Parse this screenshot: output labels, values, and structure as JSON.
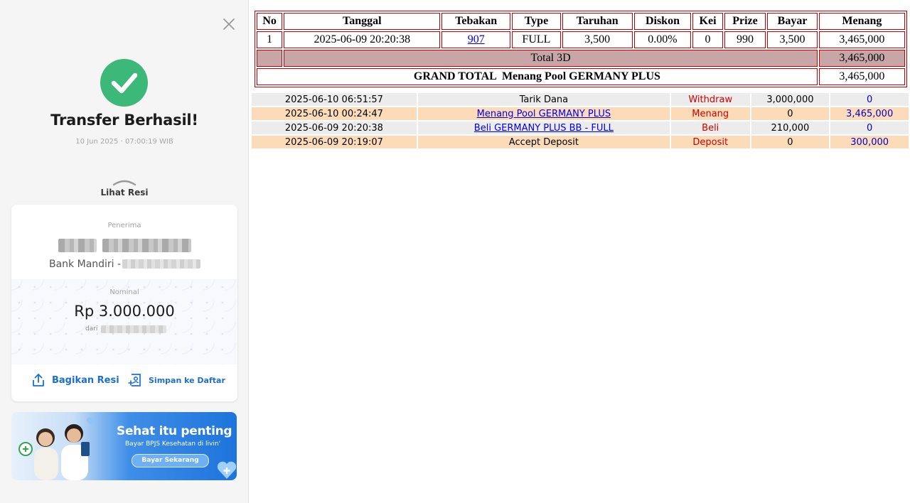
{
  "receipt": {
    "close_icon": "close-icon",
    "success_icon": "check-circle-icon",
    "title": "Transfer Berhasil!",
    "date": "10 Jun 2025 · 07:00:19 WIB",
    "view_receipt": "Lihat Resi",
    "recipient_caption": "Penerima",
    "bank_prefix": "Bank Mandiri -",
    "amount_caption": "Nominal",
    "amount": "Rp 3.000.000",
    "from_prefix": "dari",
    "share_label": "Bagikan Resi",
    "save_label": "Simpan ke Daftar",
    "colors": {
      "success": "#3cb878",
      "link": "#1a6fd0"
    }
  },
  "banner": {
    "title": "Sehat itu penting",
    "subtitle": "Bayar BPJS Kesehatan di livin'",
    "button": "Bayar Sekarang"
  },
  "bets": {
    "headers": [
      "No",
      "Tanggal",
      "Tebakan",
      "Type",
      "Taruhan",
      "Diskon",
      "Kei",
      "Prize",
      "Bayar",
      "Menang"
    ],
    "row": {
      "no": "1",
      "tanggal": "2025-06-09 20:20:38",
      "tebakan": "907",
      "type": "FULL",
      "taruhan": "3,500",
      "diskon": "0.00%",
      "kei": "0",
      "prize": "990",
      "bayar": "3,500",
      "menang": "3,465,000"
    },
    "total_label": "Total 3D",
    "total_value": "3,465,000",
    "grand_label": "GRAND TOTAL  Menang Pool GERMANY PLUS",
    "grand_value": "3,465,000"
  },
  "transactions": [
    {
      "date": "2025-06-10 06:51:57",
      "desc": "Tarik Dana",
      "type": "Withdraw",
      "debit": "3,000,000",
      "credit": "0"
    },
    {
      "date": "2025-06-10 00:24:47",
      "desc": "Menang Pool GERMANY PLUS",
      "type": "Menang",
      "debit": "0",
      "credit": "3,465,000"
    },
    {
      "date": "2025-06-09 20:20:38",
      "desc": "Beli GERMANY PLUS BB - FULL",
      "type": "Beli",
      "debit": "210,000",
      "credit": "0"
    },
    {
      "date": "2025-06-09 20:19:07",
      "desc": "Accept Deposit",
      "type": "Deposit",
      "debit": "0",
      "credit": "300,000"
    }
  ]
}
